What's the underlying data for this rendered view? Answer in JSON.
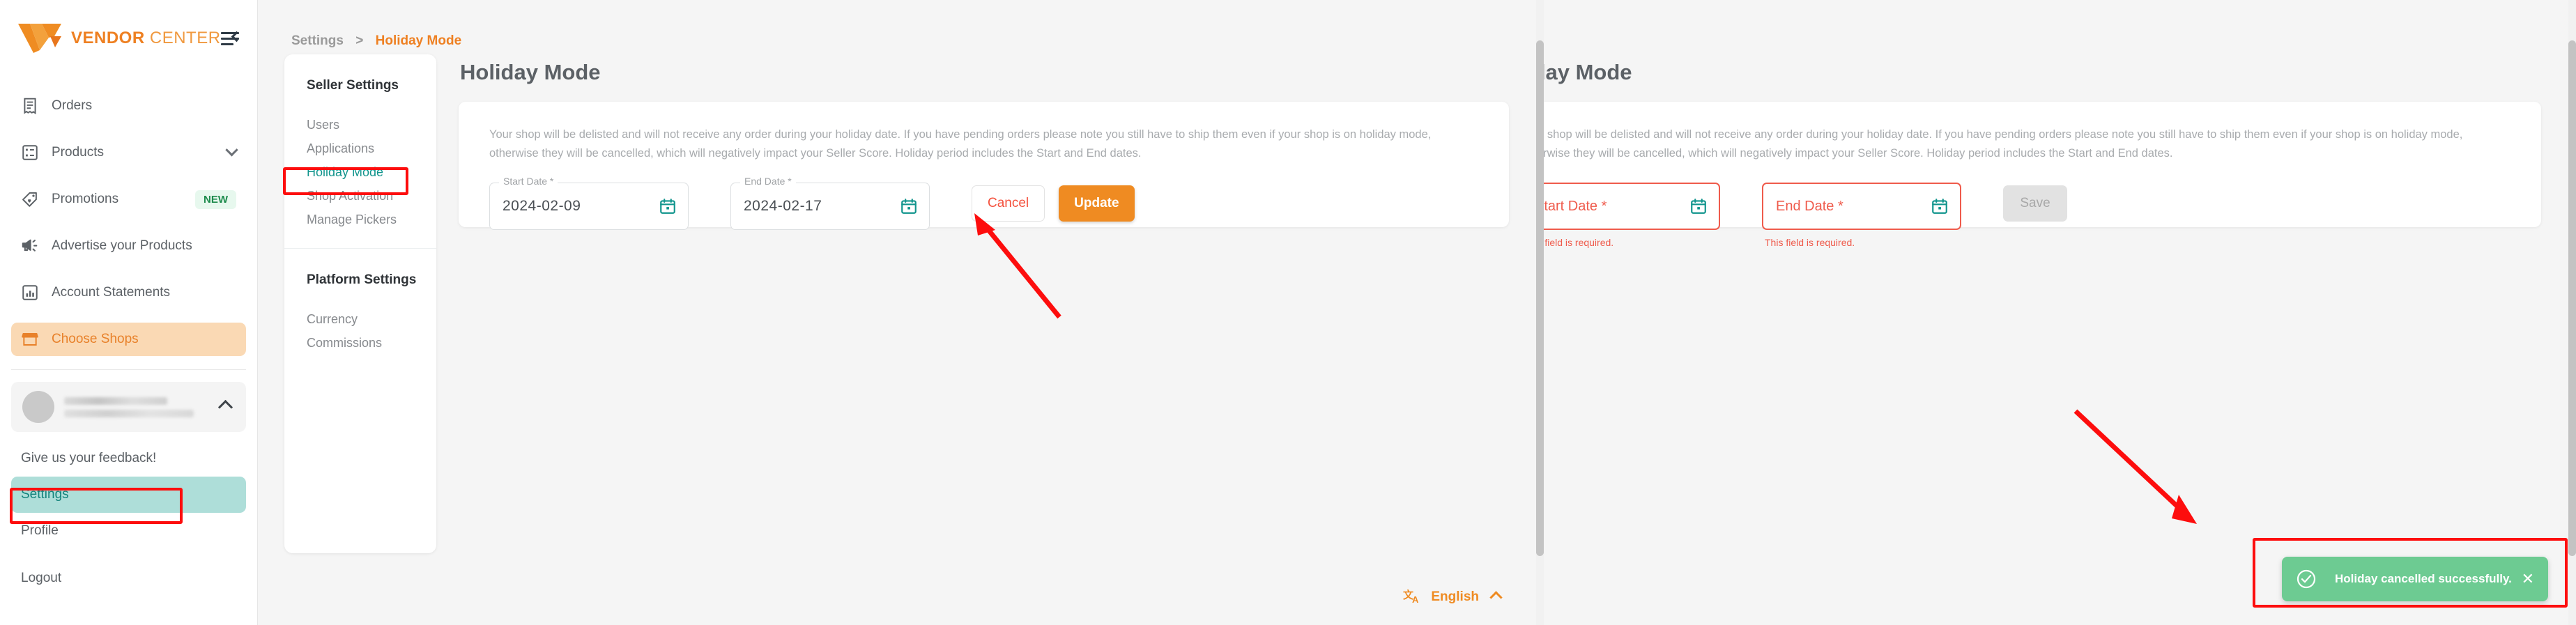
{
  "brand": {
    "bold": "VENDOR",
    "light": "CENTER",
    "collapse_icon": "menu-collapse-icon"
  },
  "sidebar": {
    "items": [
      {
        "label": "Orders",
        "icon": "orders-receipt-icon",
        "badge": "",
        "chevron": false,
        "active": false
      },
      {
        "label": "Products",
        "icon": "products-list-icon",
        "badge": "",
        "chevron": true,
        "active": false
      },
      {
        "label": "Promotions",
        "icon": "promotions-tag-icon",
        "badge": "NEW",
        "chevron": false,
        "active": false
      },
      {
        "label": "Advertise your Products",
        "icon": "advertise-megaphone-icon",
        "badge": "",
        "chevron": false,
        "active": false
      },
      {
        "label": "Account Statements",
        "icon": "account-statements-chart-icon",
        "badge": "",
        "chevron": false,
        "active": false
      },
      {
        "label": "Choose Shops",
        "icon": "choose-shops-store-icon",
        "badge": "",
        "chevron": false,
        "active": true
      }
    ],
    "user": {
      "name_redacted": true,
      "email_redacted": true,
      "chevron": "chevron-up-icon"
    },
    "footer": [
      {
        "label": "Give us your feedback!",
        "highlight": false
      },
      {
        "label": "Settings",
        "highlight": true
      },
      {
        "label": "Profile",
        "highlight": false
      },
      {
        "label": "Logout",
        "highlight": false
      }
    ]
  },
  "breadcrumb": {
    "parent": "Settings",
    "separator": ">",
    "current": "Holiday Mode"
  },
  "settings_card": {
    "group1_title": "Seller Settings",
    "group1_items": [
      {
        "label": "Users",
        "active": false
      },
      {
        "label": "Applications",
        "active": false
      },
      {
        "label": "Holiday Mode",
        "active": true
      },
      {
        "label": "Shop Activation",
        "active": false
      },
      {
        "label": "Manage Pickers",
        "active": false
      }
    ],
    "group2_title": "Platform Settings",
    "group2_items": [
      {
        "label": "Currency",
        "active": false
      },
      {
        "label": "Commissions",
        "active": false
      }
    ]
  },
  "page": {
    "title": "Holiday Mode",
    "description": "Your shop will be delisted and will not receive any order during your holiday date. If you have pending orders please note you still have to ship them even if your shop is on holiday mode, otherwise they will be cancelled, which will negatively impact your Seller Score. Holiday period includes the Start and End dates."
  },
  "form_left": {
    "start_date": {
      "legend": "Start Date *",
      "value": "2024-02-09",
      "icon": "calendar-icon"
    },
    "end_date": {
      "legend": "End Date *",
      "value": "2024-02-17",
      "icon": "calendar-icon"
    },
    "cancel_label": "Cancel",
    "update_label": "Update"
  },
  "form_right": {
    "start_date": {
      "placeholder": "Start Date *",
      "value": "",
      "error": "This field is required.",
      "icon": "calendar-icon"
    },
    "end_date": {
      "placeholder": "End Date *",
      "value": "",
      "error": "This field is required.",
      "icon": "calendar-icon"
    },
    "save_label": "Save"
  },
  "footer": {
    "language": "English",
    "lang_icon": "translate-icon",
    "chevron": "chevron-up-icon"
  },
  "toast": {
    "message": "Holiday cancelled successfully.",
    "icon": "check-circle-icon",
    "close": "close-icon"
  },
  "colors": {
    "brand_orange": "#ee8022",
    "update_button": "#ef8b22",
    "teal_accent": "#13948c",
    "teal_highlight_bg": "#aeded9",
    "active_nav_bg": "#fad9b4",
    "error_red": "#ef5b4c",
    "toast_green": "#6dcb92",
    "annotation_red": "#fd0d0d",
    "badge_green_text": "#1d8b4c",
    "badge_green_bg": "#e7f8ee"
  }
}
